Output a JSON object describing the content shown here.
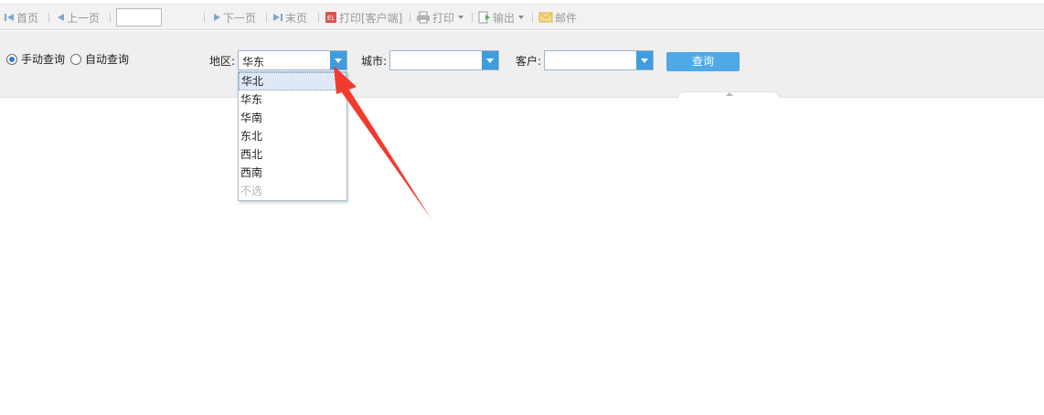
{
  "toolbar": {
    "first_page": "首页",
    "prev_page": "上一页",
    "page_input_value": "",
    "next_page": "下一页",
    "last_page": "末页",
    "print_client": "打印[客户端]",
    "print": "打印",
    "export": "输出",
    "mail": "邮件"
  },
  "params": {
    "mode_manual": "手动查询",
    "mode_auto": "自动查询",
    "region_label": "地区:",
    "region_value": "华东",
    "city_label": "城市:",
    "city_value": "",
    "customer_label": "客户:",
    "customer_value": "",
    "query_button": "查询"
  },
  "dropdown": {
    "options": [
      "华北",
      "华东",
      "华南",
      "东北",
      "西北",
      "西南",
      "不选"
    ],
    "highlighted_index": 0
  },
  "colors": {
    "accent": "#4ea9e6",
    "combo_button": "#3f9ddf",
    "annotation_arrow": "#f23a2e"
  }
}
